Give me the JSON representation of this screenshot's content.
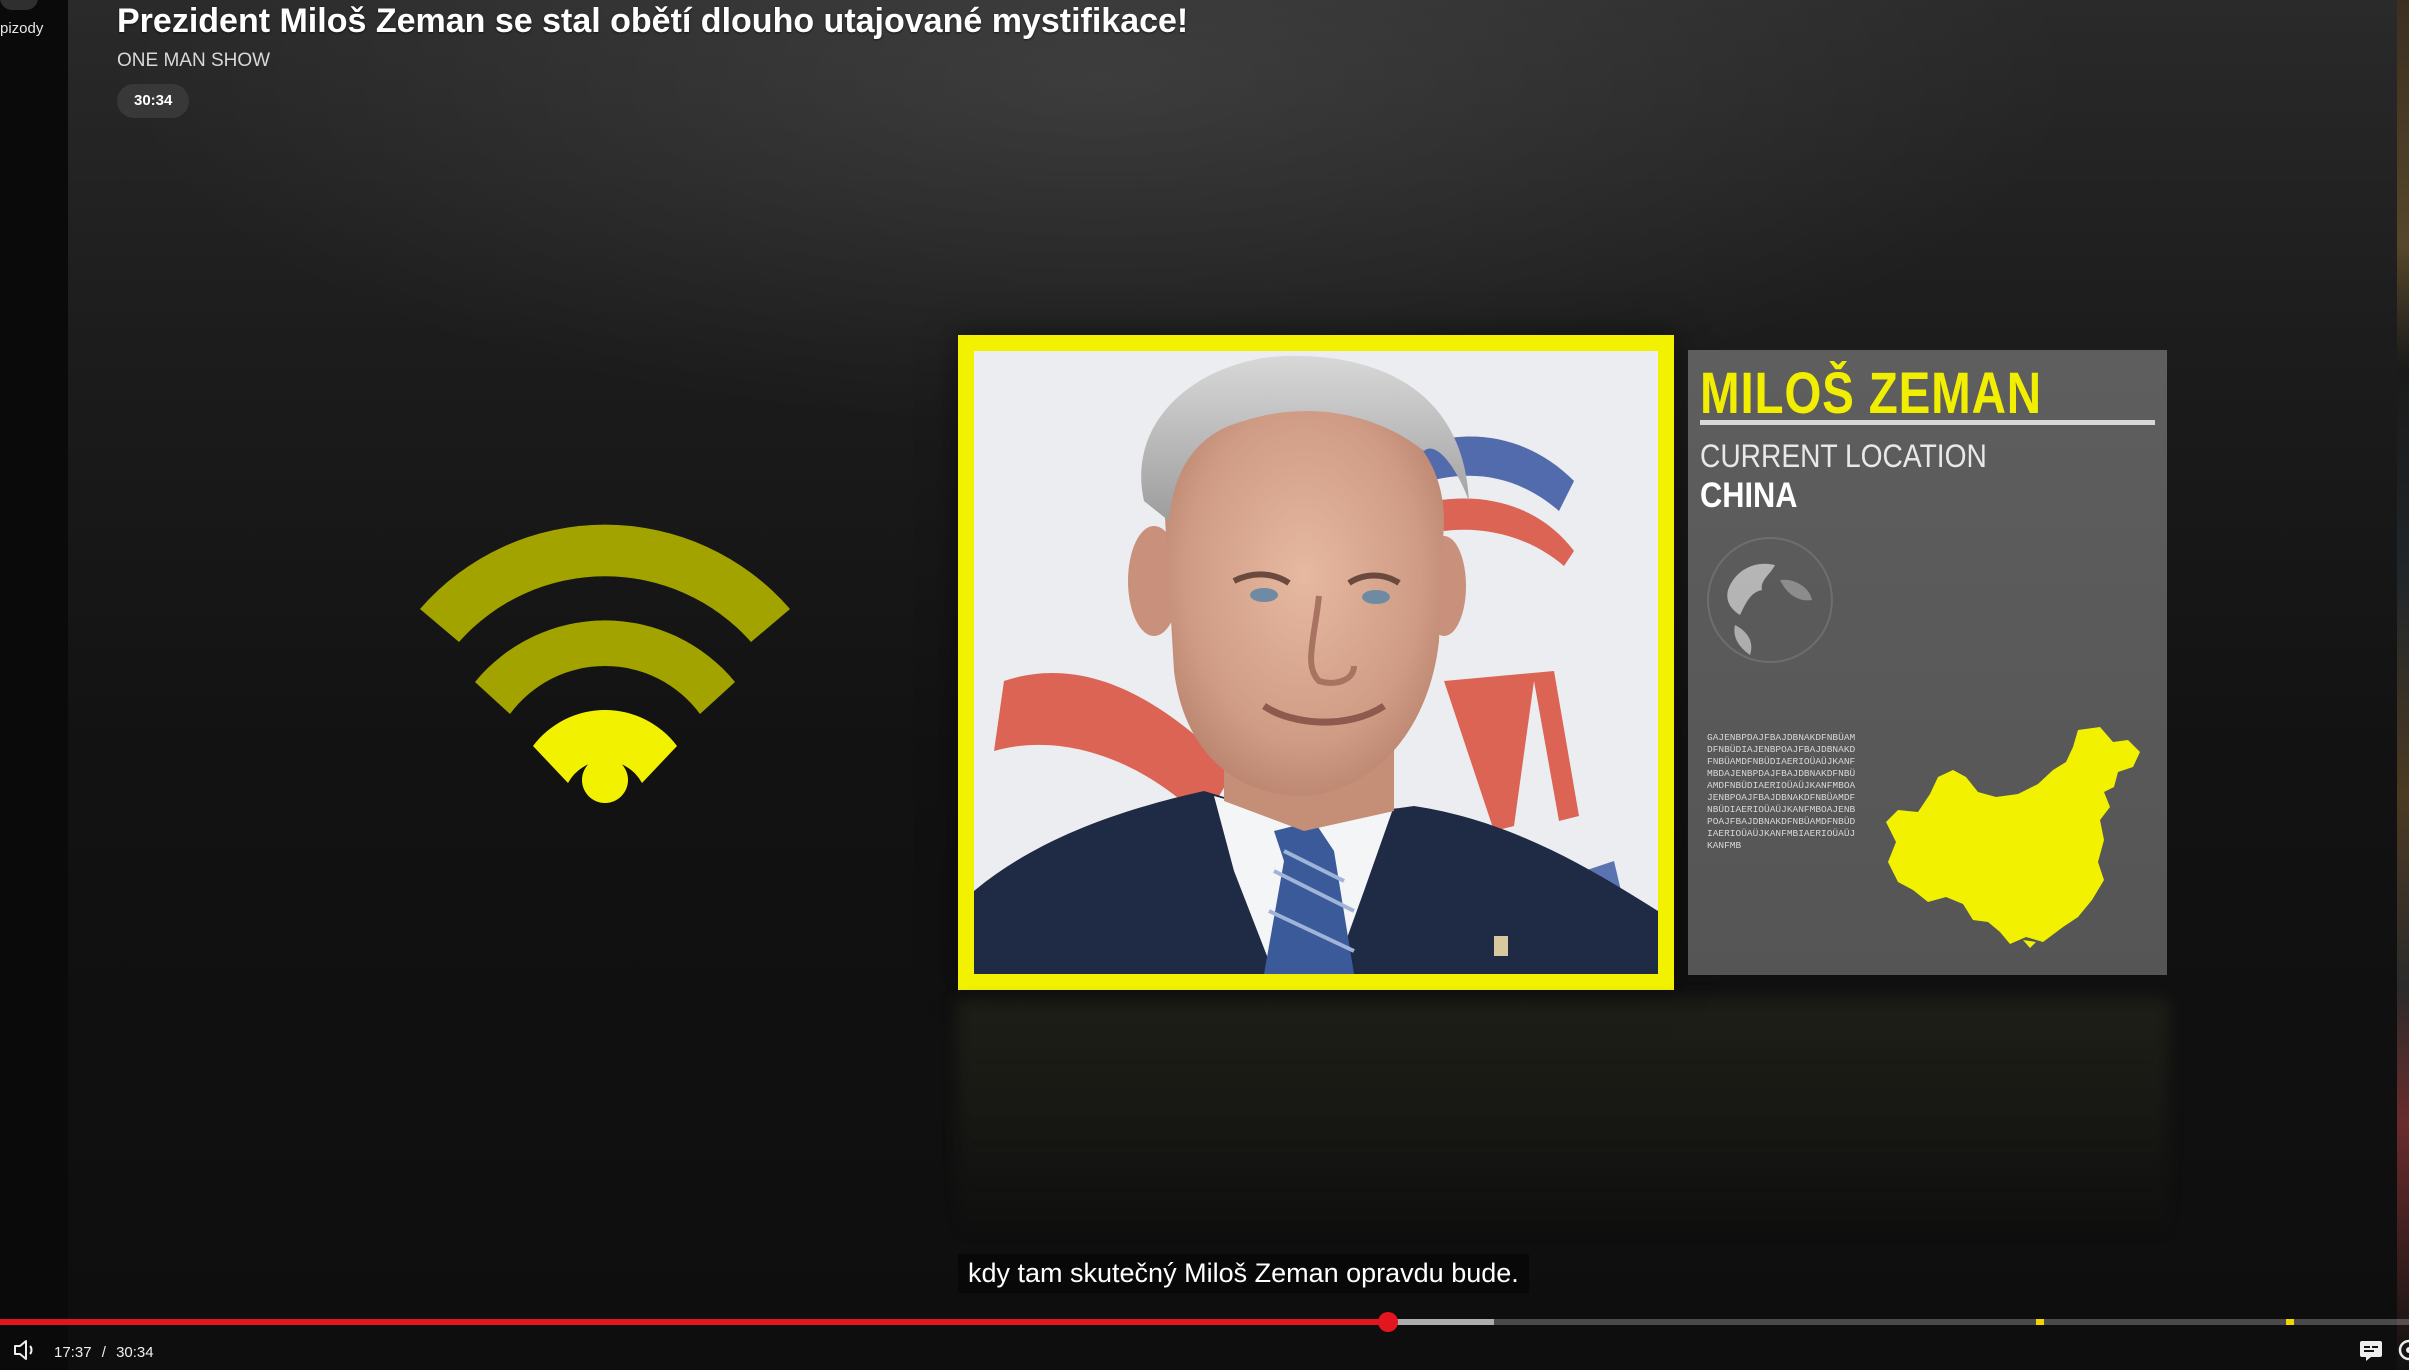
{
  "sidebar": {
    "partial_label": "pizody"
  },
  "video": {
    "title": "Prezident Miloš Zeman se stal obětí dlouho utajované mystifikace!",
    "channel": "ONE MAN SHOW",
    "duration_badge": "30:34"
  },
  "info_panel": {
    "name": "MILOŠ ZEMAN",
    "location_label": "CURRENT LOCATION",
    "location_value": "CHINA",
    "filler_text": "GAJENBPDAJFBAJDBNAKDFNBÜAMDFNBÜDIAJENBPOAJFBAJDBNAKDFNBÜAMDFNBÜDIAERIOÜAÜJKANFMBDAJENBPDAJFBAJDBNAKDFNBÜAMDFNBÜDIAERIOÜAÜJKANFMBOAJENBPOAJFBAJDBNAKDFNBÜAMDFNBÜDIAERIOÜAÜJKANFMBOAJENBPOAJFBAJDBNAKDFNBÜAMDFNBÜDIAERIOÜAÜJKANFMBIAERIOÜAÜJKANFMB"
  },
  "subtitle": {
    "text": "kdy tam skutečný Miloš Zeman opravdu bude."
  },
  "player": {
    "current_time": "17:37",
    "separator": "/",
    "total_time": "30:34",
    "progress_fraction": 0.576,
    "buffer_fraction": 0.62,
    "chapter_fractions": [
      0.845,
      0.949
    ]
  },
  "colors": {
    "accent_yellow": "#f2f200",
    "progress_red": "#e3151e",
    "panel_gray": "#5a5a5a"
  },
  "icons": {
    "mute": "volume-speaker-icon",
    "captions": "subtitles-icon",
    "settings": "gear-icon",
    "graphic": "wifi-signal-icon"
  }
}
